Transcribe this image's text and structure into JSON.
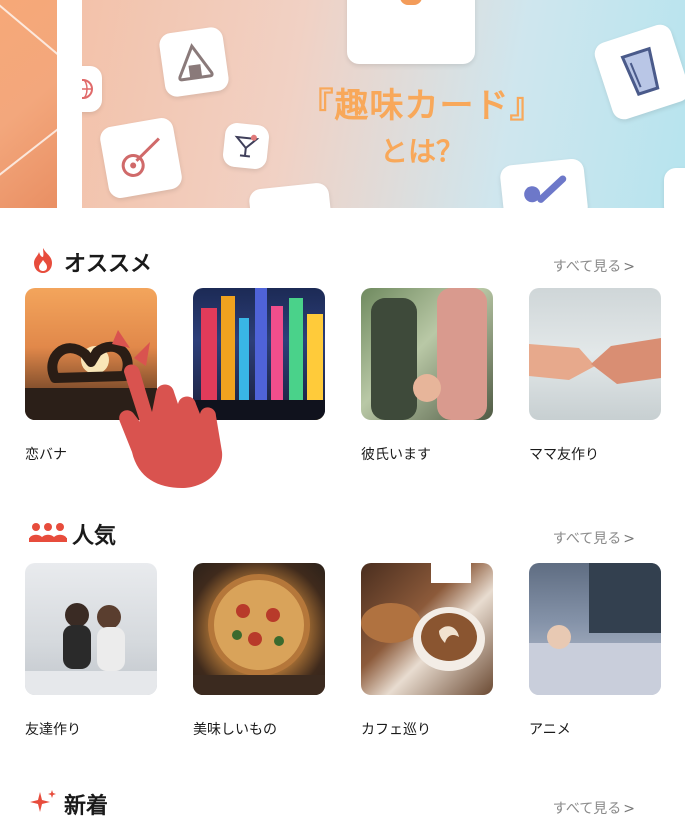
{
  "banner": {
    "title": "『趣味カード』",
    "subtitle": "とは？"
  },
  "sections": [
    {
      "id": "recommended",
      "title": "オススメ",
      "icon": "flame-icon",
      "see_all": "すべて見る",
      "cards": [
        {
          "label": "恋バナ",
          "image": "heart-hands-sunset"
        },
        {
          "label": "",
          "image": "city-night-lights"
        },
        {
          "label": "彼氏います",
          "image": "holding-hands"
        },
        {
          "label": "ママ友作り",
          "image": "handshake"
        }
      ]
    },
    {
      "id": "popular",
      "title": "人気",
      "icon": "people-group-icon",
      "see_all": "すべて見る",
      "cards": [
        {
          "label": "友達作り",
          "image": "friends-sitting"
        },
        {
          "label": "美味しいもの",
          "image": "pizza"
        },
        {
          "label": "カフェ巡り",
          "image": "coffee-croissant"
        },
        {
          "label": "アニメ",
          "image": "person-on-couch"
        }
      ]
    },
    {
      "id": "new",
      "title": "新着",
      "icon": "sparkle-icon",
      "see_all": "すべて見る",
      "cards": []
    }
  ],
  "colors": {
    "accent": "#e74c3c",
    "banner_text": "#f8a85a",
    "muted": "#8a8a8a"
  }
}
